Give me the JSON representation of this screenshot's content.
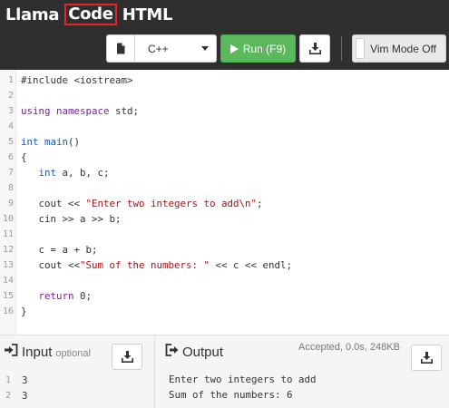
{
  "header": {
    "brand_1": "Llama",
    "brand_2": "Code",
    "brand_3": "HTML"
  },
  "toolbar": {
    "language": "C++",
    "run_label": "Run (F9)",
    "vim_label": "Vim Mode Off"
  },
  "editor": {
    "line_numbers": [
      "1",
      "2",
      "3",
      "4",
      "5",
      "6",
      "7",
      "8",
      "9",
      "10",
      "11",
      "12",
      "13",
      "14",
      "15",
      "16"
    ]
  },
  "input_panel": {
    "title": "Input",
    "subtitle": "optional",
    "lines": [
      "3",
      "3"
    ],
    "line_numbers": [
      "1",
      "2"
    ]
  },
  "output_panel": {
    "title": "Output",
    "status": "Accepted, 0.0s, 248KB",
    "lines": [
      "Enter two integers to add",
      "Sum of the numbers: 6"
    ]
  },
  "colors": {
    "header_bg": "#2f2f2f",
    "run_green": "#5cb85c",
    "highlight_red": "#e0262c",
    "keyword_purple": "#7a1fa2",
    "type_blue": "#1a5aa8",
    "string_red": "#a31515"
  }
}
